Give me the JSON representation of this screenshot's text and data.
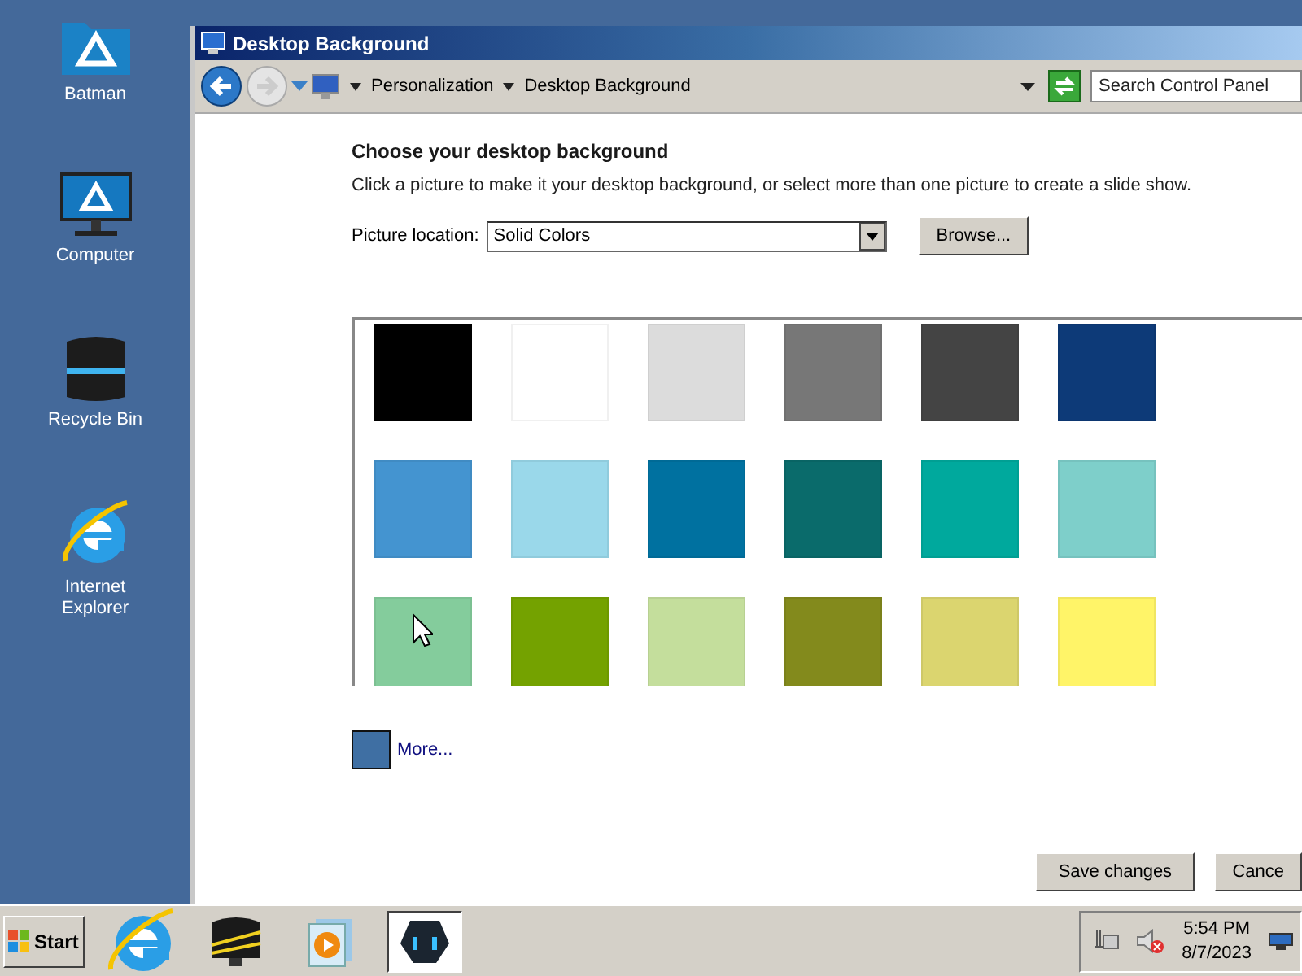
{
  "desktop_icons": [
    {
      "kind": "folder",
      "label": "Batman"
    },
    {
      "kind": "computer",
      "label": "Computer"
    },
    {
      "kind": "bin",
      "label": "Recycle Bin"
    },
    {
      "kind": "ie",
      "label": "Internet Explorer"
    }
  ],
  "window": {
    "title": "Desktop Background"
  },
  "breadcrumb": [
    "Personalization",
    "Desktop Background"
  ],
  "search": {
    "placeholder": "Search Control Panel"
  },
  "heading": "Choose your desktop background",
  "description": "Click a picture to make it your desktop background, or select more than one picture to create a slide show.",
  "picture_location": {
    "label": "Picture location:",
    "value": "Solid Colors",
    "browse": "Browse..."
  },
  "swatches": [
    {
      "color": "#000000"
    },
    {
      "color": "#ffffff"
    },
    {
      "color": "#dcdcdc"
    },
    {
      "color": "#777777"
    },
    {
      "color": "#444444"
    },
    {
      "color": "#0d3a78"
    },
    {
      "color": "#4494d0"
    },
    {
      "color": "#9ad8ea"
    },
    {
      "color": "#0071a0"
    },
    {
      "color": "#0a6b6b"
    },
    {
      "color": "#00a99d"
    },
    {
      "color": "#7ecfca"
    },
    {
      "color": "#84cc9c"
    },
    {
      "color": "#74a200"
    },
    {
      "color": "#c4de9c"
    },
    {
      "color": "#838a1c"
    },
    {
      "color": "#dbd56f"
    },
    {
      "color": "#fff468"
    }
  ],
  "more": {
    "color": "#3f6fa3",
    "label": "More..."
  },
  "buttons": [
    "Save changes",
    "Cance"
  ],
  "taskbar": {
    "start": "Start",
    "apps": [
      {
        "kind": "ie",
        "selected": false
      },
      {
        "kind": "monitor",
        "selected": false
      },
      {
        "kind": "media",
        "selected": false
      },
      {
        "kind": "app",
        "selected": true
      }
    ],
    "time": "5:54 PM",
    "date": "8/7/2023"
  }
}
